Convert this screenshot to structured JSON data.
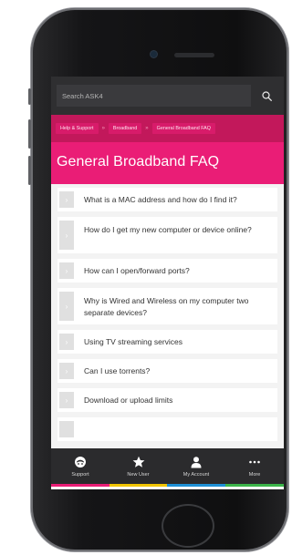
{
  "search": {
    "placeholder": "Search ASK4",
    "icon": "search-icon"
  },
  "breadcrumbs": [
    "Help & Support",
    "Broadband",
    "General Broadband FAQ"
  ],
  "breadcrumb_separator": "»",
  "page_title": "General Broadband FAQ",
  "faqs": [
    "What is a MAC address and how do I find it?",
    "How do I get my new computer or device online?",
    "How can I open/forward ports?",
    "Why is Wired and Wireless on my computer two separate devices?",
    "Using TV streaming services",
    "Can I use torrents?",
    "Download or upload limits"
  ],
  "chevron": "›",
  "tabs": [
    {
      "label": "Support",
      "icon": "support-icon",
      "color": "#ea1d76"
    },
    {
      "label": "New User",
      "icon": "star-icon",
      "color": "#f2c500"
    },
    {
      "label": "My Account",
      "icon": "user-icon",
      "color": "#1e90d6"
    },
    {
      "label": "More",
      "icon": "more-icon",
      "color": "#3cb54a"
    }
  ],
  "colors": {
    "brand_pink": "#ea1d76",
    "breadcrumb_bg": "#c2185b",
    "dark_bar": "#2f2f31"
  }
}
